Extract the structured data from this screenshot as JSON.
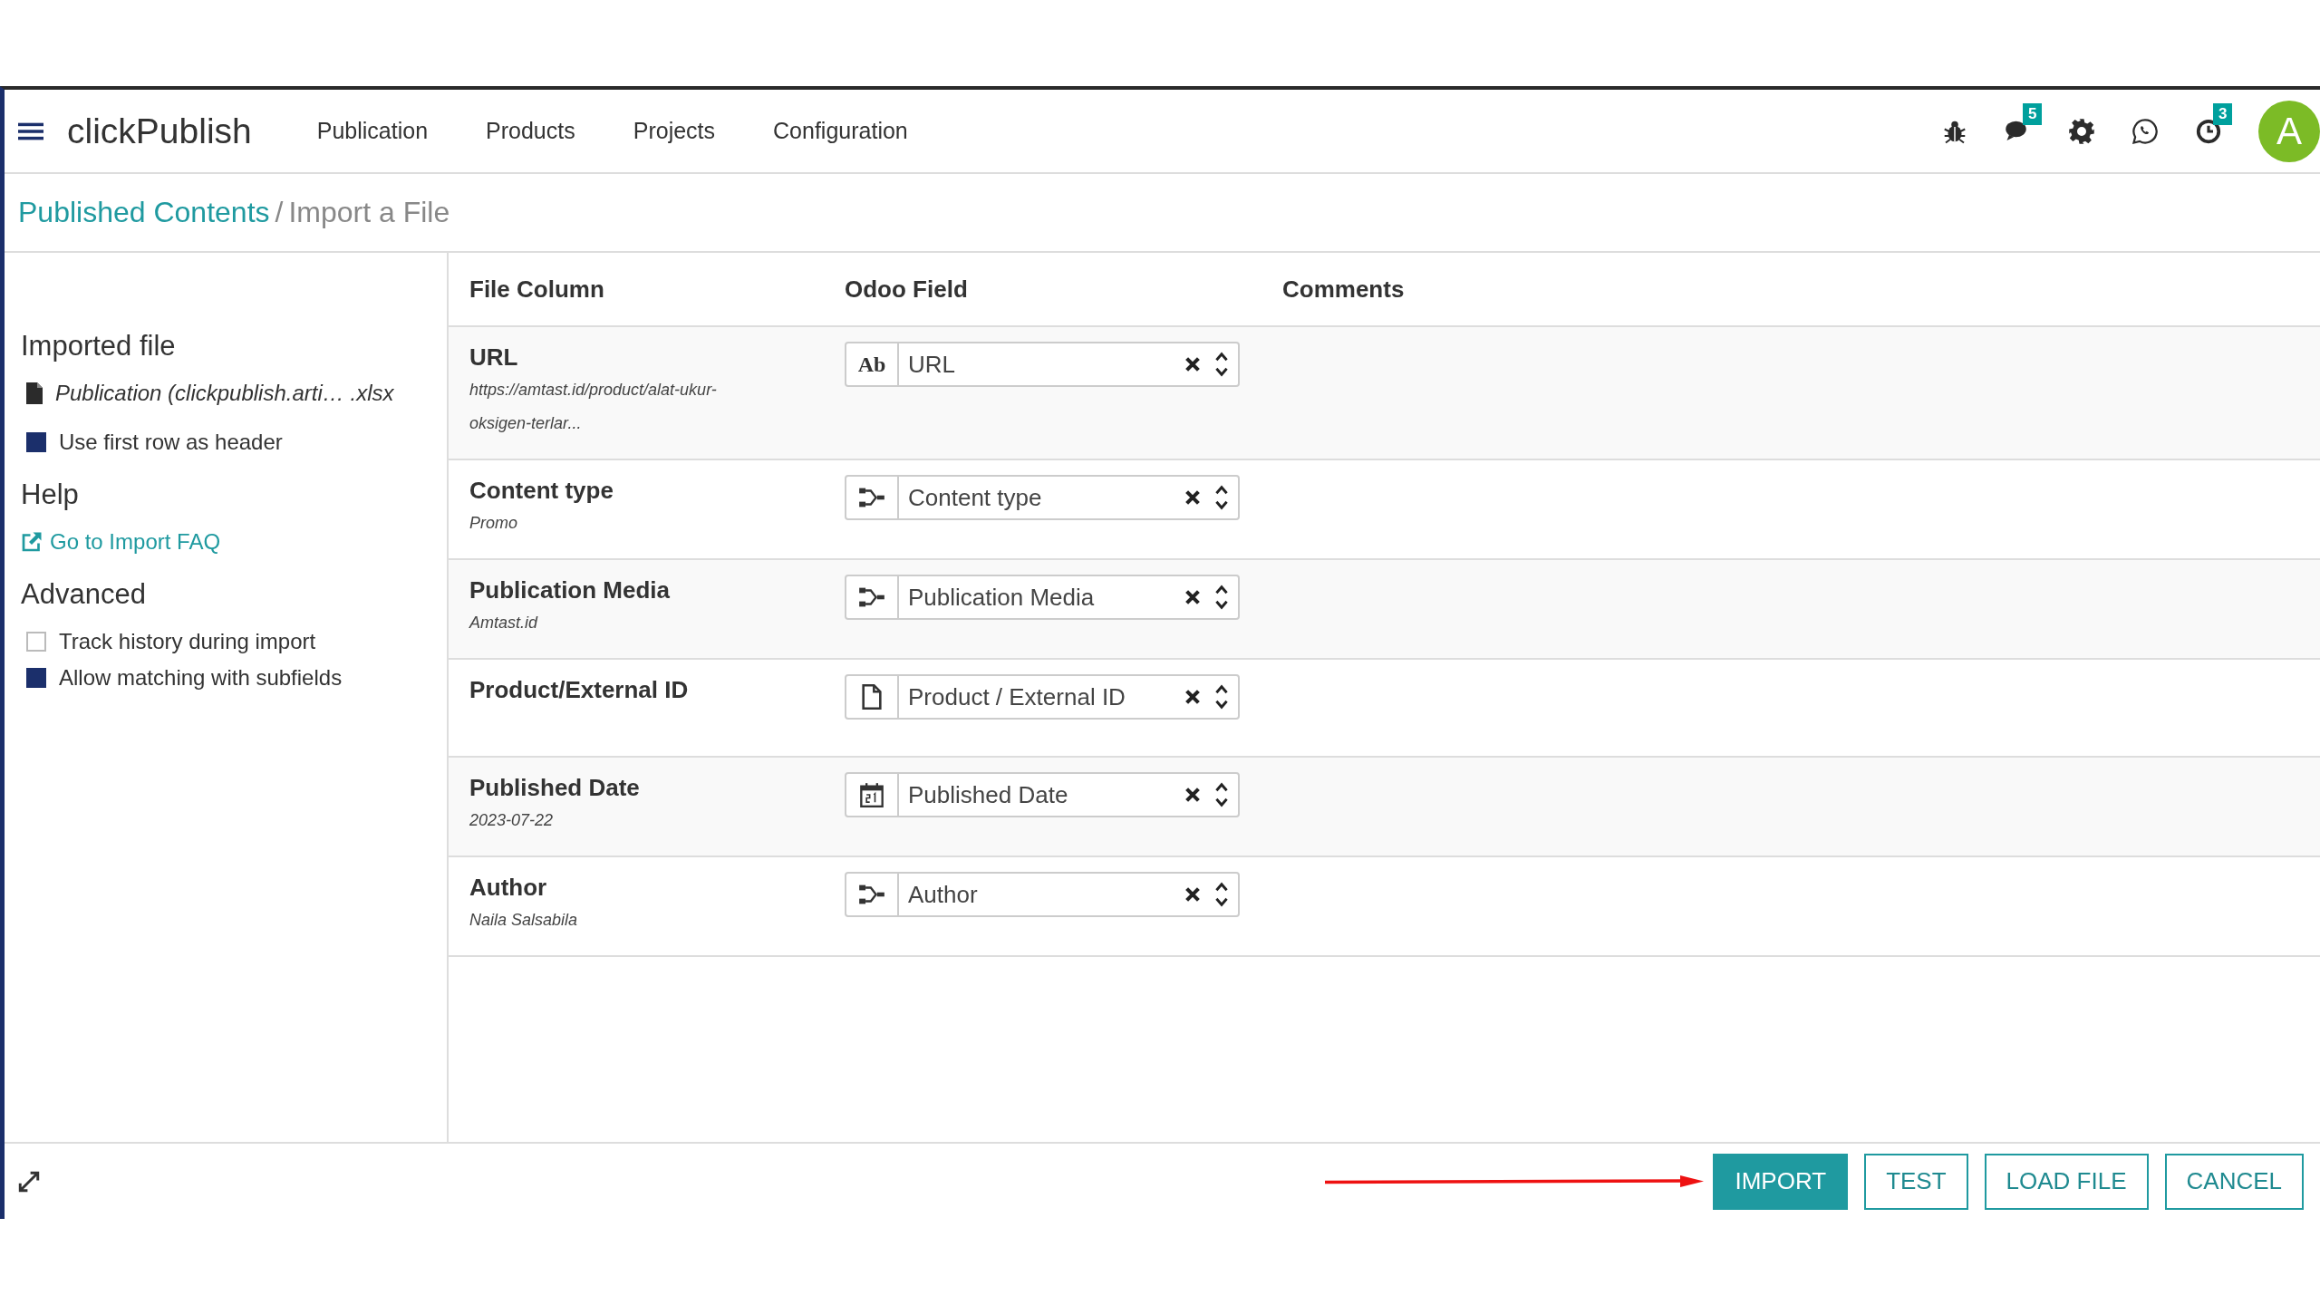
{
  "navbar": {
    "app_name": "clickPublish",
    "menu": [
      "Publication",
      "Products",
      "Projects",
      "Configuration"
    ],
    "messages_badge": "5",
    "activities_badge": "3",
    "avatar": "A"
  },
  "breadcrumb": {
    "parent": "Published Contents",
    "separator": "/",
    "current": "Import a File"
  },
  "sidebar": {
    "imported_file_heading": "Imported file",
    "file_name": "Publication (clickpublish.arti… .xlsx",
    "file_options": [
      {
        "label": "Use first row as header",
        "checked": true
      }
    ],
    "help_heading": "Help",
    "faq_link": "Go to Import FAQ",
    "advanced_heading": "Advanced",
    "advanced_options": [
      {
        "label": "Track history during import",
        "checked": false
      },
      {
        "label": "Allow matching with subfields",
        "checked": true
      }
    ]
  },
  "table": {
    "columns": [
      "File Column",
      "Odoo Field",
      "Comments"
    ],
    "rows": [
      {
        "column": "URL",
        "sample": "https://amtast.id/product/alat-ukur-oksigen-terlar...",
        "field": "URL",
        "kind": "text",
        "type_label": "Ab"
      },
      {
        "column": "Content type",
        "sample": "Promo",
        "field": "Content type",
        "kind": "relation"
      },
      {
        "column": "Publication Media",
        "sample": "Amtast.id",
        "field": "Publication Media",
        "kind": "relation"
      },
      {
        "column": "Product/External ID",
        "field": "Product / External ID",
        "kind": "file"
      },
      {
        "column": "Published Date",
        "sample": "2023-07-22",
        "field": "Published Date",
        "kind": "date"
      },
      {
        "column": "Author",
        "sample": "Naila Salsabila",
        "field": "Author",
        "kind": "relation"
      }
    ]
  },
  "footer": {
    "buttons": [
      {
        "label": "IMPORT",
        "primary": true
      },
      {
        "label": "TEST",
        "primary": false
      },
      {
        "label": "LOAD FILE",
        "primary": false
      },
      {
        "label": "CANCEL",
        "primary": false
      }
    ]
  }
}
